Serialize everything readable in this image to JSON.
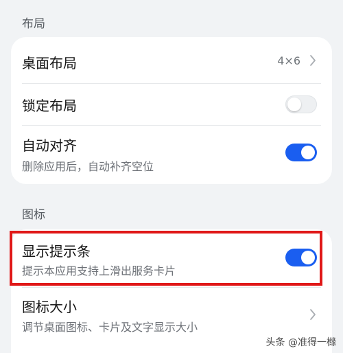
{
  "sections": {
    "layout_title": "布局",
    "icon_title": "图标"
  },
  "layout": {
    "desktop_layout": {
      "label": "桌面布局",
      "value": "4×6"
    },
    "lock_layout": {
      "label": "锁定布局",
      "toggle": false
    },
    "auto_align": {
      "label": "自动对齐",
      "desc": "删除应用后，自动补齐空位",
      "toggle": true
    }
  },
  "icon": {
    "show_hint_bar": {
      "label": "显示提示条",
      "desc": "提示本应用支持上滑出服务卡片",
      "toggle": true
    },
    "icon_size": {
      "label": "图标大小",
      "desc": "调节桌面图标、卡片及文字显示大小"
    }
  },
  "watermark": "头条 @准得一橼",
  "colors": {
    "accent": "#1a5ef0",
    "highlight": "#e01818"
  }
}
